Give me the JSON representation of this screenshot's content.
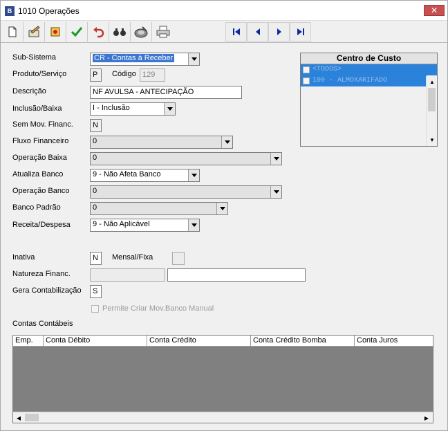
{
  "window": {
    "title": "1010 Operações",
    "icon_letter": "B",
    "close": "✕"
  },
  "toolbar": {
    "buttons": [
      "new-icon",
      "edit-icon",
      "delete-icon",
      "confirm-icon",
      "undo-icon",
      "search-icon",
      "report-icon",
      "print-icon"
    ],
    "nav": [
      "first-record-icon",
      "previous-record-icon",
      "next-record-icon",
      "last-record-icon"
    ]
  },
  "form": {
    "sub_sistema": {
      "label": "Sub-Sistema",
      "value": "CR - Contas à Receber"
    },
    "produto_servico": {
      "label": "Produto/Serviço",
      "value": "P"
    },
    "codigo": {
      "label": "Código",
      "value": "129"
    },
    "descricao": {
      "label": "Descrição",
      "value": "NF AVULSA - ANTECIPAÇÃO"
    },
    "inclusao_baixa": {
      "label": "Inclusão/Baixa",
      "value": "I - Inclusão"
    },
    "sem_mov_financ": {
      "label": "Sem Mov. Financ.",
      "value": "N"
    },
    "fluxo_financeiro": {
      "label": "Fluxo Financeiro",
      "value": "0"
    },
    "operacao_baixa": {
      "label": "Operação Baixa",
      "value": "0"
    },
    "atualiza_banco": {
      "label": "Atualiza Banco",
      "value": "9 - Não Afeta Banco"
    },
    "operacao_banco": {
      "label": "Operação Banco",
      "value": "0"
    },
    "banco_padrao": {
      "label": "Banco Padrão",
      "value": "0"
    },
    "receita_despesa": {
      "label": "Receita/Despesa",
      "value": "9 - Não Aplicável"
    },
    "inativa": {
      "label": "Inativa",
      "value": "N"
    },
    "mensal_fixa": {
      "label": "Mensal/Fixa",
      "value": ""
    },
    "natureza_financ": {
      "label": "Natureza Financ.",
      "code": "",
      "description": ""
    },
    "gera_contabilizacao": {
      "label": "Gera Contabilização",
      "value": "S"
    },
    "permite_mov_banco": {
      "label": "Permite Criar Mov.Banco Manual",
      "checked": false
    }
  },
  "centro_custo": {
    "title": "Centro de Custo",
    "items": [
      "<TODOS>",
      "100 - ALMOXARIFADO"
    ]
  },
  "contas": {
    "title": "Contas Contábeis",
    "columns": [
      "Emp.",
      "Conta Débito",
      "Conta Crédito",
      "Conta Crédito Bomba",
      "Conta Juros"
    ],
    "rows": []
  }
}
